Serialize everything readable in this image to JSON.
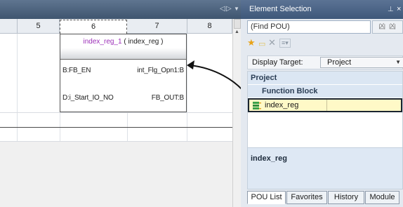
{
  "editor": {
    "tab_nav": {
      "prev": "◁",
      "next": "▷",
      "menu": "▼"
    },
    "columns": [
      "5",
      "6",
      "7",
      "8"
    ],
    "selected_column": "6",
    "function_block": {
      "instance_name": "index_reg_1",
      "type_name": "( index_reg )",
      "inputs": [
        "B:FB_EN",
        "D:i_Start_IO_NO"
      ],
      "outputs": [
        "int_Flg_Opn1:B",
        "FB_OUT:B"
      ]
    }
  },
  "element_selection": {
    "title": "Element Selection",
    "pin_icon": "pin-icon",
    "close_icon": "close-icon",
    "search": {
      "value": "(Find POU)",
      "button_glyph": "凶 凶"
    },
    "toolbar": {
      "sort_label": "≡▾"
    },
    "display_target": {
      "label": "Display Target:",
      "value": "Project"
    },
    "tree": {
      "root": "Project",
      "category": "Function Block",
      "items": [
        {
          "label": "index_reg",
          "icon": "function-block-icon"
        }
      ]
    },
    "description": {
      "title": "index_reg"
    },
    "tabs": [
      "POU List",
      "Favorites",
      "History",
      "Module"
    ],
    "active_tab": "POU List"
  }
}
